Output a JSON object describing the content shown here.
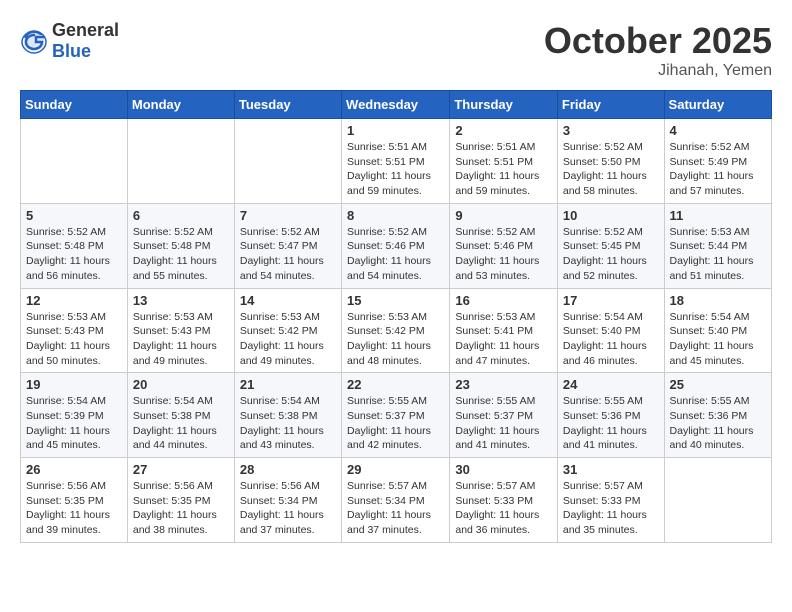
{
  "header": {
    "logo_general": "General",
    "logo_blue": "Blue",
    "month": "October 2025",
    "location": "Jihanah, Yemen"
  },
  "weekdays": [
    "Sunday",
    "Monday",
    "Tuesday",
    "Wednesday",
    "Thursday",
    "Friday",
    "Saturday"
  ],
  "weeks": [
    [
      {
        "day": "",
        "sunrise": "",
        "sunset": "",
        "daylight": ""
      },
      {
        "day": "",
        "sunrise": "",
        "sunset": "",
        "daylight": ""
      },
      {
        "day": "",
        "sunrise": "",
        "sunset": "",
        "daylight": ""
      },
      {
        "day": "1",
        "sunrise": "Sunrise: 5:51 AM",
        "sunset": "Sunset: 5:51 PM",
        "daylight": "Daylight: 11 hours and 59 minutes."
      },
      {
        "day": "2",
        "sunrise": "Sunrise: 5:51 AM",
        "sunset": "Sunset: 5:51 PM",
        "daylight": "Daylight: 11 hours and 59 minutes."
      },
      {
        "day": "3",
        "sunrise": "Sunrise: 5:52 AM",
        "sunset": "Sunset: 5:50 PM",
        "daylight": "Daylight: 11 hours and 58 minutes."
      },
      {
        "day": "4",
        "sunrise": "Sunrise: 5:52 AM",
        "sunset": "Sunset: 5:49 PM",
        "daylight": "Daylight: 11 hours and 57 minutes."
      }
    ],
    [
      {
        "day": "5",
        "sunrise": "Sunrise: 5:52 AM",
        "sunset": "Sunset: 5:48 PM",
        "daylight": "Daylight: 11 hours and 56 minutes."
      },
      {
        "day": "6",
        "sunrise": "Sunrise: 5:52 AM",
        "sunset": "Sunset: 5:48 PM",
        "daylight": "Daylight: 11 hours and 55 minutes."
      },
      {
        "day": "7",
        "sunrise": "Sunrise: 5:52 AM",
        "sunset": "Sunset: 5:47 PM",
        "daylight": "Daylight: 11 hours and 54 minutes."
      },
      {
        "day": "8",
        "sunrise": "Sunrise: 5:52 AM",
        "sunset": "Sunset: 5:46 PM",
        "daylight": "Daylight: 11 hours and 54 minutes."
      },
      {
        "day": "9",
        "sunrise": "Sunrise: 5:52 AM",
        "sunset": "Sunset: 5:46 PM",
        "daylight": "Daylight: 11 hours and 53 minutes."
      },
      {
        "day": "10",
        "sunrise": "Sunrise: 5:52 AM",
        "sunset": "Sunset: 5:45 PM",
        "daylight": "Daylight: 11 hours and 52 minutes."
      },
      {
        "day": "11",
        "sunrise": "Sunrise: 5:53 AM",
        "sunset": "Sunset: 5:44 PM",
        "daylight": "Daylight: 11 hours and 51 minutes."
      }
    ],
    [
      {
        "day": "12",
        "sunrise": "Sunrise: 5:53 AM",
        "sunset": "Sunset: 5:43 PM",
        "daylight": "Daylight: 11 hours and 50 minutes."
      },
      {
        "day": "13",
        "sunrise": "Sunrise: 5:53 AM",
        "sunset": "Sunset: 5:43 PM",
        "daylight": "Daylight: 11 hours and 49 minutes."
      },
      {
        "day": "14",
        "sunrise": "Sunrise: 5:53 AM",
        "sunset": "Sunset: 5:42 PM",
        "daylight": "Daylight: 11 hours and 49 minutes."
      },
      {
        "day": "15",
        "sunrise": "Sunrise: 5:53 AM",
        "sunset": "Sunset: 5:42 PM",
        "daylight": "Daylight: 11 hours and 48 minutes."
      },
      {
        "day": "16",
        "sunrise": "Sunrise: 5:53 AM",
        "sunset": "Sunset: 5:41 PM",
        "daylight": "Daylight: 11 hours and 47 minutes."
      },
      {
        "day": "17",
        "sunrise": "Sunrise: 5:54 AM",
        "sunset": "Sunset: 5:40 PM",
        "daylight": "Daylight: 11 hours and 46 minutes."
      },
      {
        "day": "18",
        "sunrise": "Sunrise: 5:54 AM",
        "sunset": "Sunset: 5:40 PM",
        "daylight": "Daylight: 11 hours and 45 minutes."
      }
    ],
    [
      {
        "day": "19",
        "sunrise": "Sunrise: 5:54 AM",
        "sunset": "Sunset: 5:39 PM",
        "daylight": "Daylight: 11 hours and 45 minutes."
      },
      {
        "day": "20",
        "sunrise": "Sunrise: 5:54 AM",
        "sunset": "Sunset: 5:38 PM",
        "daylight": "Daylight: 11 hours and 44 minutes."
      },
      {
        "day": "21",
        "sunrise": "Sunrise: 5:54 AM",
        "sunset": "Sunset: 5:38 PM",
        "daylight": "Daylight: 11 hours and 43 minutes."
      },
      {
        "day": "22",
        "sunrise": "Sunrise: 5:55 AM",
        "sunset": "Sunset: 5:37 PM",
        "daylight": "Daylight: 11 hours and 42 minutes."
      },
      {
        "day": "23",
        "sunrise": "Sunrise: 5:55 AM",
        "sunset": "Sunset: 5:37 PM",
        "daylight": "Daylight: 11 hours and 41 minutes."
      },
      {
        "day": "24",
        "sunrise": "Sunrise: 5:55 AM",
        "sunset": "Sunset: 5:36 PM",
        "daylight": "Daylight: 11 hours and 41 minutes."
      },
      {
        "day": "25",
        "sunrise": "Sunrise: 5:55 AM",
        "sunset": "Sunset: 5:36 PM",
        "daylight": "Daylight: 11 hours and 40 minutes."
      }
    ],
    [
      {
        "day": "26",
        "sunrise": "Sunrise: 5:56 AM",
        "sunset": "Sunset: 5:35 PM",
        "daylight": "Daylight: 11 hours and 39 minutes."
      },
      {
        "day": "27",
        "sunrise": "Sunrise: 5:56 AM",
        "sunset": "Sunset: 5:35 PM",
        "daylight": "Daylight: 11 hours and 38 minutes."
      },
      {
        "day": "28",
        "sunrise": "Sunrise: 5:56 AM",
        "sunset": "Sunset: 5:34 PM",
        "daylight": "Daylight: 11 hours and 37 minutes."
      },
      {
        "day": "29",
        "sunrise": "Sunrise: 5:57 AM",
        "sunset": "Sunset: 5:34 PM",
        "daylight": "Daylight: 11 hours and 37 minutes."
      },
      {
        "day": "30",
        "sunrise": "Sunrise: 5:57 AM",
        "sunset": "Sunset: 5:33 PM",
        "daylight": "Daylight: 11 hours and 36 minutes."
      },
      {
        "day": "31",
        "sunrise": "Sunrise: 5:57 AM",
        "sunset": "Sunset: 5:33 PM",
        "daylight": "Daylight: 11 hours and 35 minutes."
      },
      {
        "day": "",
        "sunrise": "",
        "sunset": "",
        "daylight": ""
      }
    ]
  ]
}
